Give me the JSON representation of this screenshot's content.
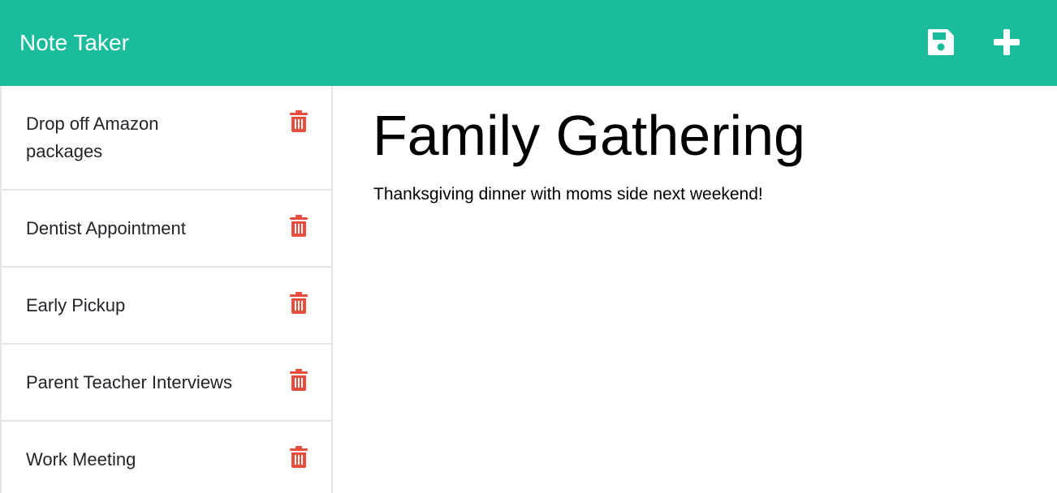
{
  "header": {
    "brand": "Note Taker",
    "save_icon": "floppy-disk-icon",
    "new_icon": "plus-icon",
    "color": "#1abc9c"
  },
  "notes": [
    {
      "title": "Drop off Amazon packages"
    },
    {
      "title": "Dentist Appointment"
    },
    {
      "title": "Early Pickup"
    },
    {
      "title": "Parent Teacher Interviews"
    },
    {
      "title": "Work Meeting"
    }
  ],
  "active_note": {
    "title": "Family Gathering",
    "text": "Thanksgiving dinner with moms side next weekend!"
  },
  "delete_icon": "trash-icon",
  "delete_color": "#e74c3c"
}
